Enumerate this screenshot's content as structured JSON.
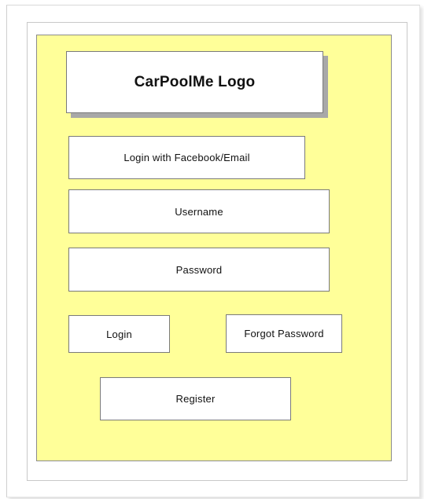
{
  "logo": {
    "label": "CarPoolMe Logo"
  },
  "social_login": {
    "label": "Login with Facebook/Email"
  },
  "username_field": {
    "label": "Username"
  },
  "password_field": {
    "label": "Password"
  },
  "login_button": {
    "label": "Login"
  },
  "forgot_password_button": {
    "label": "Forgot Password"
  },
  "register_button": {
    "label": "Register"
  },
  "colors": {
    "mockup_background": "#ffff99",
    "box_background": "#ffffff",
    "box_border": "#7a7a7a",
    "logo_shadow": "#a8a8a8"
  }
}
